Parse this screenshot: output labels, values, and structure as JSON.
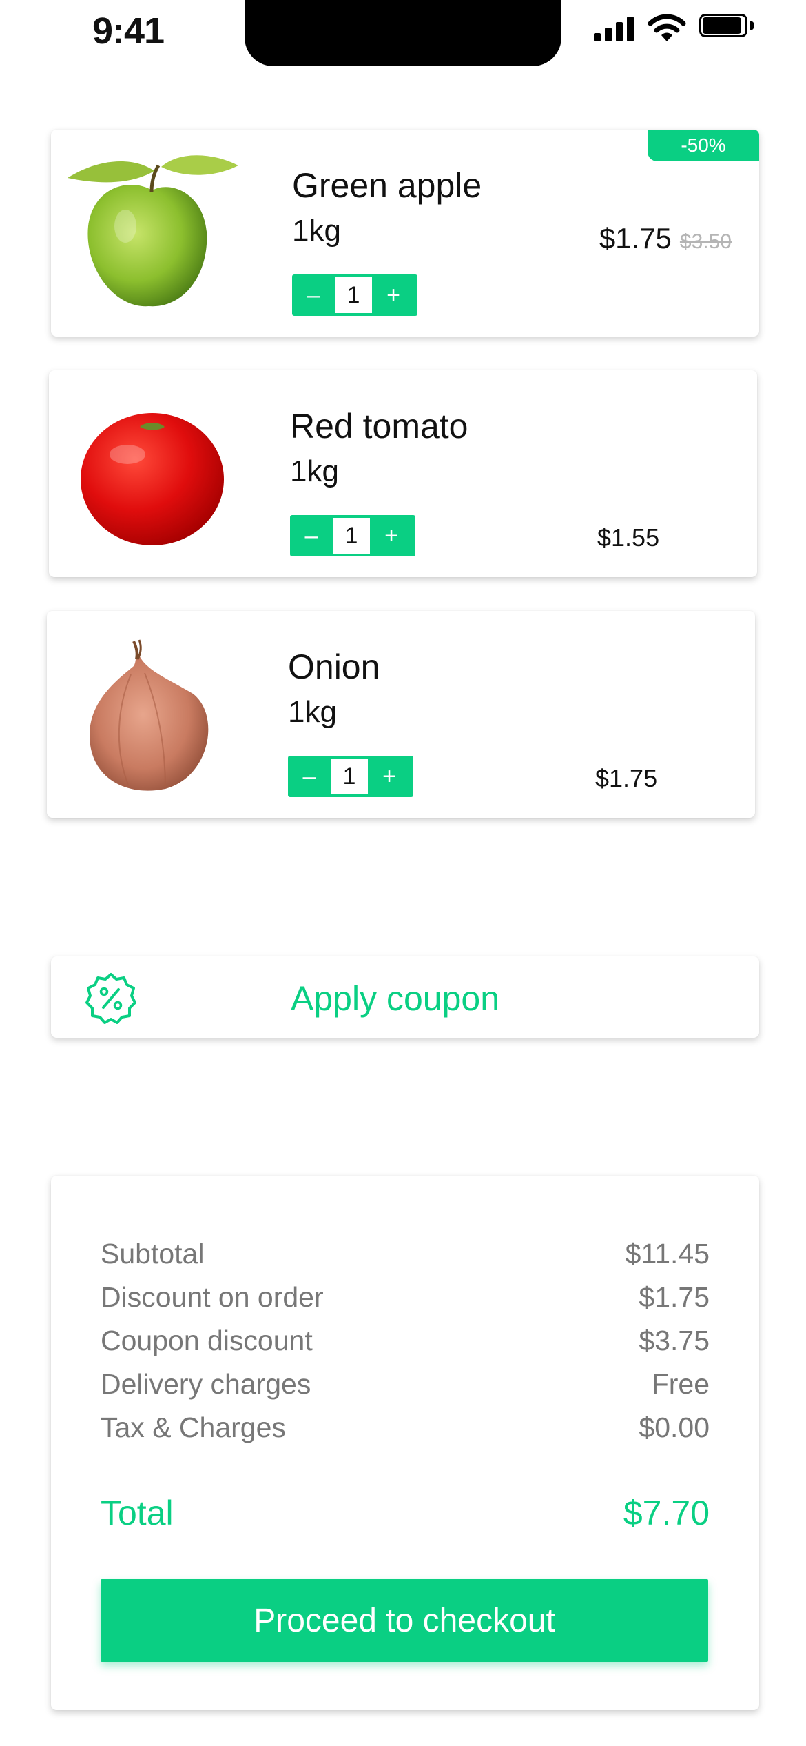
{
  "status_bar": {
    "time": "9:41"
  },
  "colors": {
    "accent": "#0ACF83",
    "muted_text": "#777777",
    "strike_price": "#B5B5B5"
  },
  "cart": {
    "items": [
      {
        "name": "Green apple",
        "weight": "1kg",
        "quantity": "1",
        "price": "$1.75",
        "old_price": "$3.50",
        "badge": "-50%",
        "image_icon": "green-apple"
      },
      {
        "name": "Red tomato",
        "weight": "1kg",
        "quantity": "1",
        "price": "$1.55",
        "image_icon": "red-tomato"
      },
      {
        "name": "Onion",
        "weight": "1kg",
        "quantity": "1",
        "price": "$1.75",
        "image_icon": "onion"
      }
    ],
    "stepper": {
      "minus": "–",
      "plus": "+"
    }
  },
  "coupon": {
    "label": "Apply coupon",
    "icon": "percent-badge-icon"
  },
  "summary": {
    "rows": [
      {
        "label": "Subtotal",
        "value": "$11.45"
      },
      {
        "label": "Discount on order",
        "value": "$1.75"
      },
      {
        "label": "Coupon discount",
        "value": "$3.75"
      },
      {
        "label": "Delivery charges",
        "value": "Free"
      },
      {
        "label": "Tax & Charges",
        "value": "$0.00"
      }
    ],
    "total_label": "Total",
    "total_value": "$7.70",
    "checkout_label": "Proceed to checkout"
  }
}
